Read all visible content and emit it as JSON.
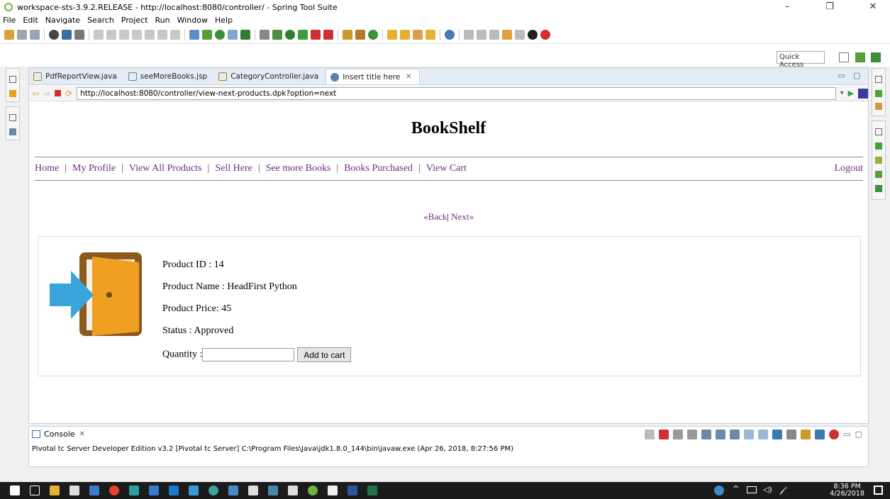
{
  "window": {
    "title": "workspace-sts-3.9.2.RELEASE - http://localhost:8080/controller/ - Spring Tool Suite",
    "minimize": "–",
    "maximize": "❐",
    "close": "✕"
  },
  "menu": [
    "File",
    "Edit",
    "Navigate",
    "Search",
    "Project",
    "Run",
    "Window",
    "Help"
  ],
  "quick_access": "Quick Access",
  "tabs": [
    {
      "label": "PdfReportView.java",
      "icon_color": "#e8b000"
    },
    {
      "label": "seeMoreBooks.jsp",
      "icon_color": "#7a7aa0"
    },
    {
      "label": "CategoryController.java",
      "icon_color": "#e8b000"
    },
    {
      "label": "Insert title here",
      "icon_color": "#5a7fa8",
      "active": true
    }
  ],
  "browser": {
    "url": "http://localhost:8080/controller/view-next-products.dpk?option=next"
  },
  "page": {
    "title": "BookShelf",
    "nav": [
      "Home",
      "My Profile",
      "View All Products",
      "Sell Here",
      "See more Books",
      "Books Purchased",
      "View Cart"
    ],
    "logout": "Logout",
    "back": "«Back",
    "separator": "|",
    "next": "Next»",
    "product": {
      "id_text": "Product ID : 14",
      "name_text": "Product Name : HeadFirst Python",
      "price_text": "Product Price: 45",
      "status_text": "Status : Approved",
      "quantity_label": "Quantity :",
      "quantity_value": "",
      "add_button": "Add to cart"
    }
  },
  "console": {
    "tab_label": "Console",
    "line": "Pivotal tc Server Developer Edition v3.2 [Pivotal tc Server] C:\\Program Files\\Java\\jdk1.8.0_144\\bin\\javaw.exe (Apr 26, 2018, 8:27:56 PM)"
  },
  "taskbar": {
    "time": "8:36 PM",
    "date": "4/26/2018"
  },
  "colors": {
    "link": "#6b2e83",
    "door_frame": "#8a5a1e",
    "door": "#f0a020",
    "arrow": "#3aa5dc"
  }
}
